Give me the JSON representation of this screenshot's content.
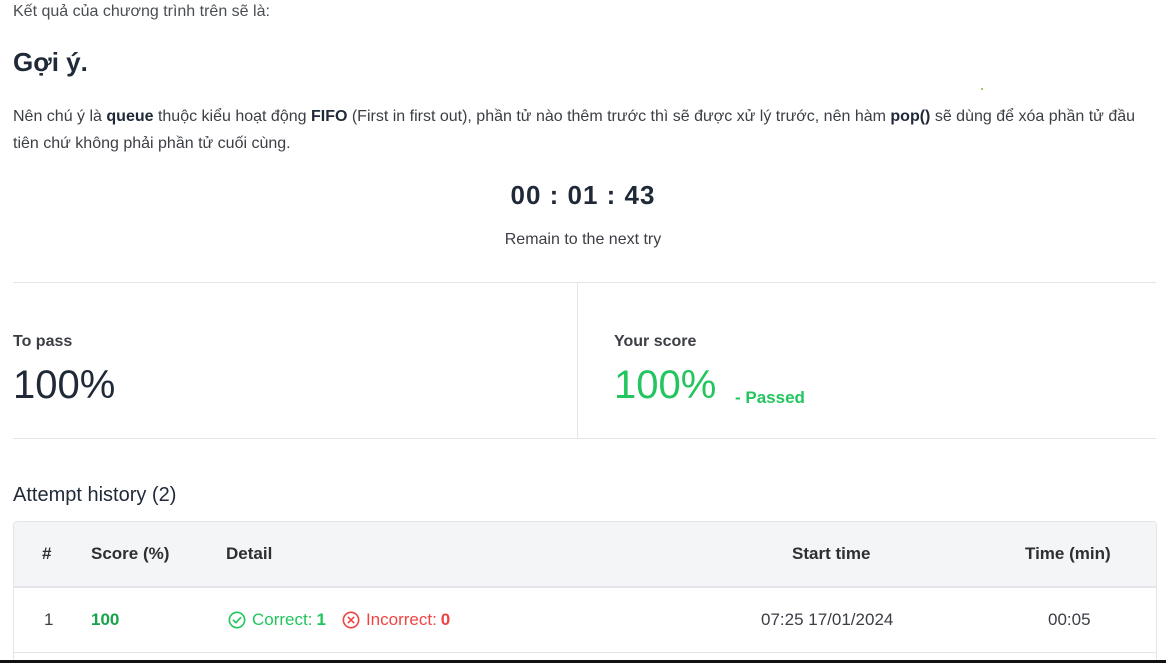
{
  "intro": {
    "text": "Kết quả của chương trình trên sẽ là:"
  },
  "hint": {
    "title": "Gợi ý.",
    "p_part1": "Nên chú ý là ",
    "p_queue": "queue",
    "p_part2": " thuộc kiểu hoạt động ",
    "p_fifo": "FIFO",
    "p_part3": " (First in first out), phần tử nào thêm trước thì sẽ được xử lý trước, nên hàm ",
    "p_pop": "pop()",
    "p_part4": " sẽ dùng để xóa phần tử đầu tiên chứ không phải phần tử cuối cùng."
  },
  "timer": {
    "value": "00 : 01 : 43",
    "caption": "Remain to the next try"
  },
  "score": {
    "to_pass_label": "To pass",
    "to_pass_value": "100%",
    "your_score_label": "Your score",
    "your_score_value": "100%",
    "status": "- Passed"
  },
  "history": {
    "title": "Attempt history (2)",
    "columns": [
      "#",
      "Score (%)",
      "Detail",
      "Start time",
      "Time (min)"
    ],
    "rows": [
      {
        "index": "1",
        "score": "100",
        "correct_label": "Correct:",
        "correct_count": "1",
        "incorrect_label": "Incorrect:",
        "incorrect_count": "0",
        "start_time": "07:25 17/01/2024",
        "duration": "00:05"
      }
    ]
  },
  "colors": {
    "pass_green": "#22c55e",
    "fail_red": "#ef4444",
    "text_dark": "#1f2937"
  },
  "icons": {
    "correct": "check-circle-icon",
    "incorrect": "x-circle-icon"
  }
}
